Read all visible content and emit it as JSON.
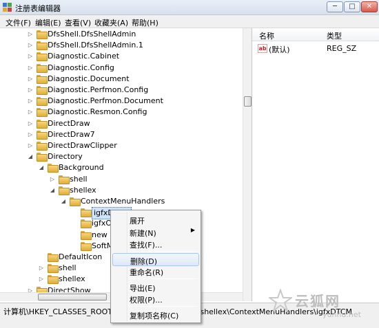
{
  "window": {
    "title": "注册表编辑器",
    "min_glyph": "─",
    "max_glyph": "□",
    "close_glyph": "✕"
  },
  "menu": [
    "文件(F)",
    "编辑(E)",
    "查看(V)",
    "收藏夹(A)",
    "帮助(H)"
  ],
  "tree": [
    {
      "label": "DfsShell.DfsShellAdmin",
      "level": 0,
      "expander": "▷"
    },
    {
      "label": "DfsShell.DfsShellAdmin.1",
      "level": 0,
      "expander": "▷"
    },
    {
      "label": "Diagnostic.Cabinet",
      "level": 0,
      "expander": "▷"
    },
    {
      "label": "Diagnostic.Config",
      "level": 0,
      "expander": "▷"
    },
    {
      "label": "Diagnostic.Document",
      "level": 0,
      "expander": "▷"
    },
    {
      "label": "Diagnostic.Perfmon.Config",
      "level": 0,
      "expander": "▷"
    },
    {
      "label": "Diagnostic.Perfmon.Document",
      "level": 0,
      "expander": "▷"
    },
    {
      "label": "Diagnostic.Resmon.Config",
      "level": 0,
      "expander": "▷"
    },
    {
      "label": "DirectDraw",
      "level": 0,
      "expander": "▷"
    },
    {
      "label": "DirectDraw7",
      "level": 0,
      "expander": "▷"
    },
    {
      "label": "DirectDrawClipper",
      "level": 0,
      "expander": "▷"
    },
    {
      "label": "Directory",
      "level": 0,
      "expander": "◢"
    },
    {
      "label": "Background",
      "level": 1,
      "expander": "◢"
    },
    {
      "label": "shell",
      "level": 2,
      "expander": "▷"
    },
    {
      "label": "shellex",
      "level": 2,
      "expander": "◢"
    },
    {
      "label": "ContextMenuHandlers",
      "level": 3,
      "expander": "◢"
    },
    {
      "label": "igfxDTCM",
      "level": 4,
      "expander": "",
      "selected": true
    },
    {
      "label": "igfxOSP",
      "level": 4,
      "expander": ""
    },
    {
      "label": "new",
      "level": 4,
      "expander": ""
    },
    {
      "label": "SoftManager",
      "level": 4,
      "expander": ""
    },
    {
      "label": "DefaultIcon",
      "level": 1,
      "expander": ""
    },
    {
      "label": "shell",
      "level": 1,
      "expander": "▷"
    },
    {
      "label": "shellex",
      "level": 1,
      "expander": "▷"
    },
    {
      "label": "DirectShow",
      "level": 0,
      "expander": "▷"
    }
  ],
  "list": {
    "columns": [
      "名称",
      "类型"
    ],
    "rows": [
      {
        "icon": "ab",
        "name": "(默认)",
        "type": "REG_SZ"
      }
    ]
  },
  "status": "计算机\\HKEY_CLASSES_ROOT\\Directory\\Background\\shellex\\ContextMenuHandlers\\igfxDTCM",
  "context_menu": [
    {
      "label": "展开",
      "submenu": false
    },
    {
      "label": "新建(N)",
      "submenu": true
    },
    {
      "label": "查找(F)...",
      "submenu": false
    },
    {
      "sep": true
    },
    {
      "label": "删除(D)",
      "submenu": false,
      "highlight": true
    },
    {
      "label": "重命名(R)",
      "submenu": false
    },
    {
      "sep": true
    },
    {
      "label": "导出(E)",
      "submenu": false
    },
    {
      "label": "权限(P)...",
      "submenu": false
    },
    {
      "sep": true
    },
    {
      "label": "复制项名称(C)",
      "submenu": false
    }
  ],
  "watermark": {
    "main": "云狐网",
    "sub": "yunhu.net"
  },
  "colors": {
    "selection": "#cfe3fa",
    "folder": "#e2ad38",
    "highlight_border": "#a9c6ec"
  }
}
